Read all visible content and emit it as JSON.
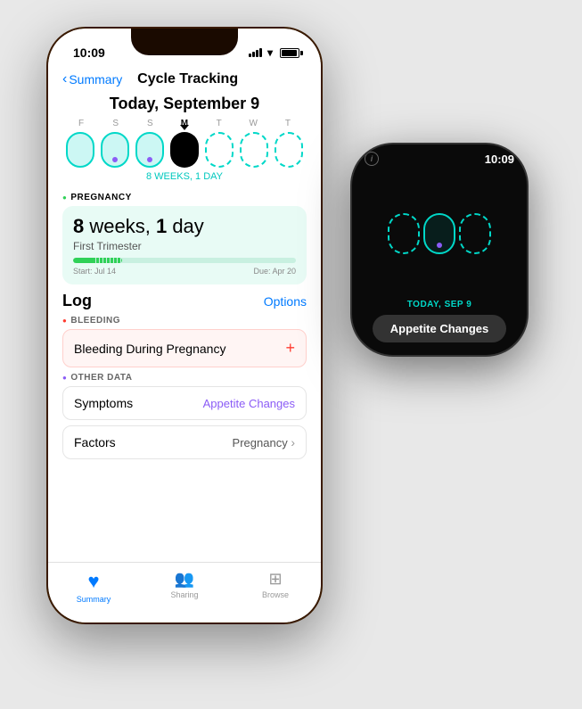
{
  "scene": {
    "background": "#e8e8e8"
  },
  "iphone": {
    "status_bar": {
      "time": "10:09"
    },
    "nav": {
      "back_label": "Summary",
      "title": "Cycle Tracking"
    },
    "date_header": "Today, September 9",
    "calendar": {
      "days": [
        "F",
        "S",
        "S",
        "M",
        "T",
        "W",
        "T"
      ],
      "weeks_label": "8 WEEKS, 1 DAY",
      "today_index": 3
    },
    "pregnancy": {
      "section_label": "PREGNANCY",
      "weeks_number": "8",
      "weeks_unit": " weeks, ",
      "days_number": "1",
      "days_unit": " day",
      "trimester": "First Trimester",
      "start_date": "Start: Jul 14",
      "due_date": "Due: Apr 20",
      "progress_percent": 22
    },
    "log": {
      "title": "Log",
      "options": "Options",
      "bleeding_section": "BLEEDING",
      "bleeding_item": "Bleeding During Pregnancy",
      "other_section": "OTHER DATA",
      "symptoms_label": "Symptoms",
      "symptoms_value": "Appetite Changes",
      "factors_label": "Factors",
      "factors_value": "Pregnancy"
    },
    "tab_bar": {
      "items": [
        {
          "label": "Summary",
          "active": true
        },
        {
          "label": "Sharing",
          "active": false
        },
        {
          "label": "Browse",
          "active": false
        }
      ]
    }
  },
  "watch": {
    "time": "10:09",
    "date": "TODAY, SEP 9",
    "pill_text": "Appetite Changes"
  },
  "icons": {
    "back": "‹",
    "plus": "+",
    "chevron": "›",
    "heart": "♥",
    "share": "👥",
    "browse": "⊞",
    "info": "i"
  }
}
